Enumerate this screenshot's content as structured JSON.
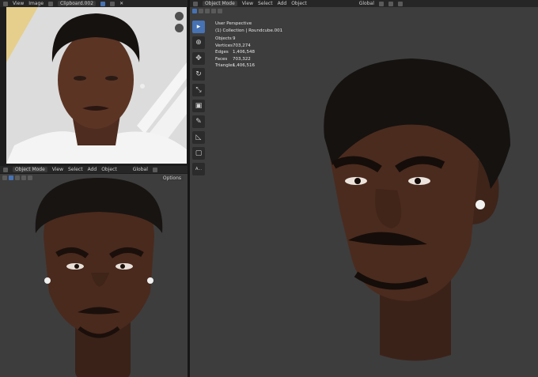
{
  "image_editor": {
    "menu": [
      "View",
      "Image"
    ],
    "image_name": "Clipboard.002"
  },
  "viewport_left": {
    "mode": "Object Mode",
    "menu": [
      "View",
      "Select",
      "Add",
      "Object"
    ],
    "orientation": "Global",
    "options_label": "Options"
  },
  "viewport_main": {
    "mode": "Object Mode",
    "menu": [
      "View",
      "Select",
      "Add",
      "Object"
    ],
    "orientation": "Global",
    "overlay_title": "User Perspective",
    "collection_line": "(1) Collection | Roundcube.001",
    "stats": [
      {
        "label": "Objects",
        "value": "9"
      },
      {
        "label": "Vertices",
        "value": "703,274"
      },
      {
        "label": "Edges",
        "value": "1,406,548"
      },
      {
        "label": "Faces",
        "value": "703,322"
      },
      {
        "label": "Triangles",
        "value": "1,406,516"
      }
    ],
    "text_tool_label": "A..."
  },
  "colors": {
    "accent": "#4772b3",
    "viewport_bg": "#3d3d3d",
    "header_bg": "#262626"
  }
}
